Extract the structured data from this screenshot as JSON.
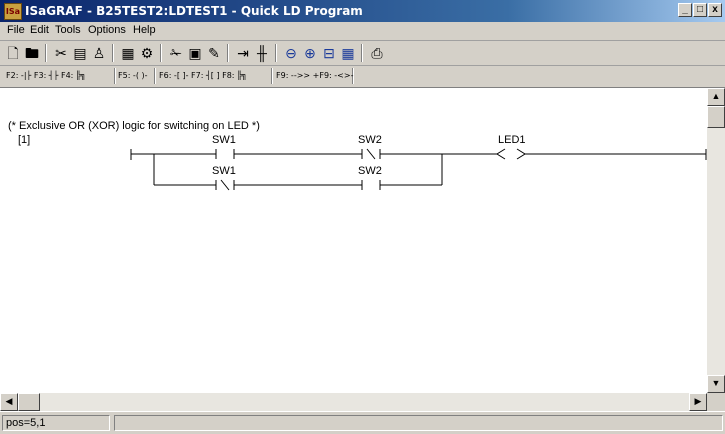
{
  "window": {
    "app_icon_text": "ISa",
    "title": "ISaGRAF - B25TEST2:LDTEST1 - Quick LD Program",
    "minimize": "_",
    "maximize": "□",
    "close": "x"
  },
  "menu": [
    "File",
    "Edit",
    "Tools",
    "Options",
    "Help"
  ],
  "toolbar_icons": [
    "new-document-icon",
    "open-folder-icon",
    "cut-icon",
    "copy-icon",
    "paste-icon",
    "variables-icon",
    "connect-icon",
    "scissors-icon",
    "clipboard-icon",
    "brush-icon",
    "insert-icon",
    "parallel-icon",
    "zoom-out-icon",
    "zoom-in-icon",
    "fit-icon",
    "grid-icon",
    "print-icon"
  ],
  "fkeys": [
    "F2: -|├ F3: ┤├ F4: ╠╗",
    "F5: -( )-",
    "F6: -[ ]- F7: ┤[ ] F8: ╠╗",
    "F9: -->> +F9: -<>-"
  ],
  "ladder": {
    "comment": "(* Exclusive OR (XOR) logic for switching on LED *)",
    "rung_number": "[1]",
    "contacts": [
      {
        "label": "SW1",
        "row": 1,
        "negated": false
      },
      {
        "label": "SW2",
        "row": 1,
        "negated": true
      },
      {
        "label": "SW1",
        "row": 2,
        "negated": true
      },
      {
        "label": "SW2",
        "row": 2,
        "negated": false
      }
    ],
    "coil_label": "LED1"
  },
  "status": {
    "position": "pos=5,1",
    "message": ""
  },
  "colors": {
    "title_start": "#0a246a",
    "title_end": "#a6caf0",
    "chrome": "#d4d0c8"
  }
}
